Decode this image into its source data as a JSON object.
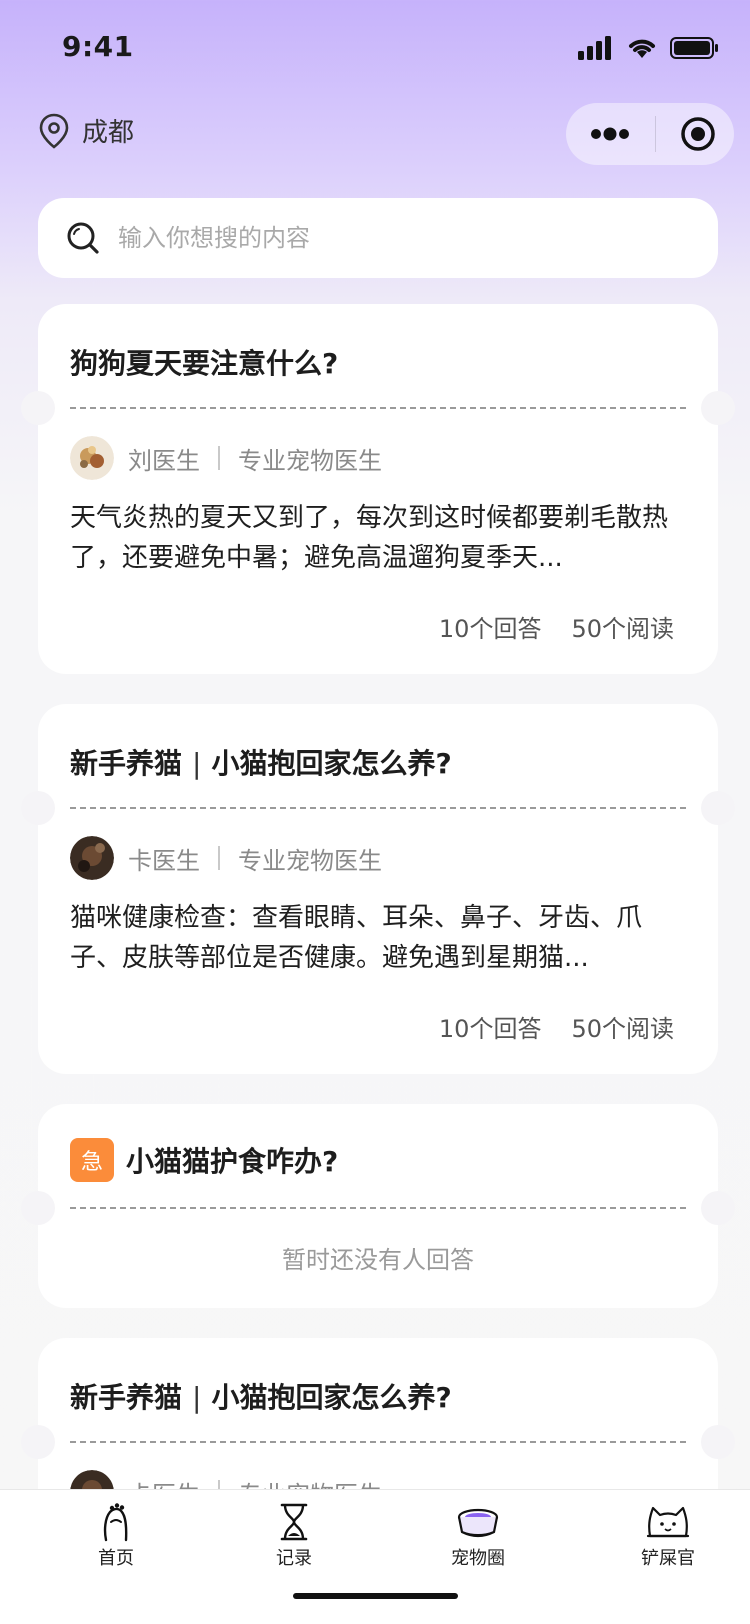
{
  "status_bar": {
    "time": "9:41"
  },
  "header": {
    "location": "成都",
    "capsule": {
      "more_icon": "more-dots-icon",
      "close_icon": "target-circle-icon"
    }
  },
  "search": {
    "placeholder": "输入你想搜的内容",
    "value": ""
  },
  "posts": [
    {
      "title": "狗狗夏天要注意什么?",
      "author": "刘医生",
      "role": "专业宠物医生",
      "excerpt": "天气炎热的夏天又到了，每次到这时候都要剃毛散热了，还要避免中暑；避免高温遛狗夏季天...",
      "answers": "10个回答",
      "reads": "50个阅读"
    },
    {
      "title_a": "新手养猫",
      "title_b": "小猫抱回家怎么养?",
      "author": "卡医生",
      "role": "专业宠物医生",
      "excerpt": "猫咪健康检查：查看眼睛、耳朵、鼻子、牙齿、爪子、皮肤等部位是否健康。避免遇到星期猫...",
      "answers": "10个回答",
      "reads": "50个阅读"
    },
    {
      "badge": "急",
      "title": "小猫猫护食咋办?",
      "empty_text": "暂时还没有人回答"
    },
    {
      "title_a": "新手养猫",
      "title_b": "小猫抱回家怎么养?",
      "author": "卡医生",
      "role": "专业宠物医生"
    }
  ],
  "tabbar": {
    "tabs": [
      {
        "label": "首页",
        "icon": "paw-hand-icon"
      },
      {
        "label": "记录",
        "icon": "hourglass-icon"
      },
      {
        "label": "宠物圈",
        "icon": "pet-bowl-icon"
      },
      {
        "label": "铲屎官",
        "icon": "cat-face-icon"
      }
    ]
  },
  "colors": {
    "accent": "#c6b2fb",
    "urgent": "#fb8c3a",
    "bowl": "#8a63f0"
  }
}
